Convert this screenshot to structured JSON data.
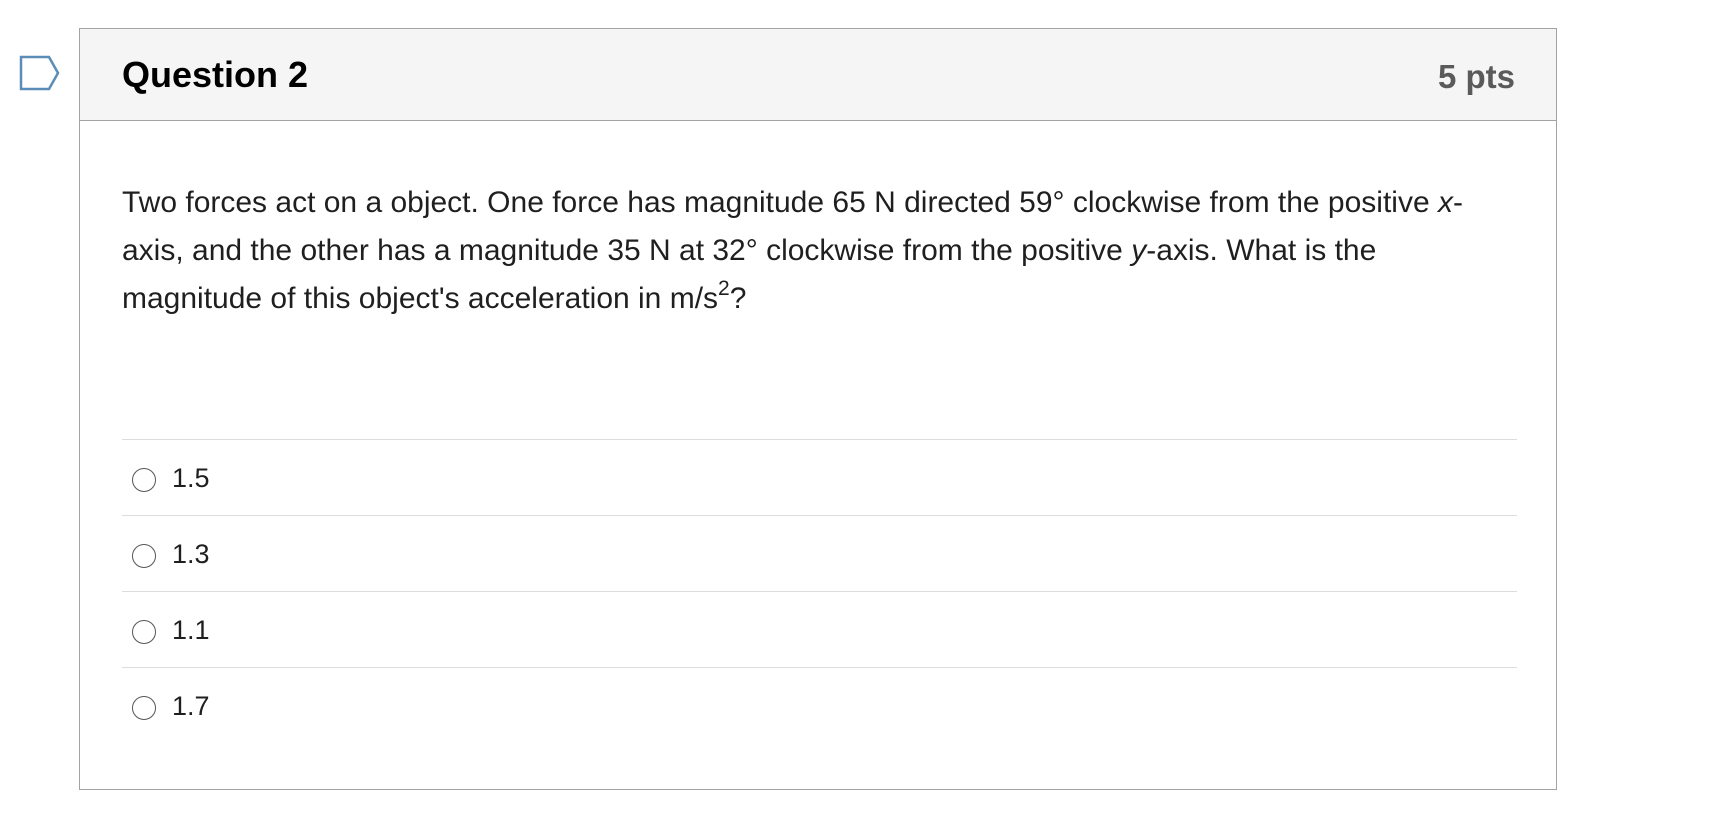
{
  "question": {
    "title": "Question 2",
    "points": "5 pts",
    "text_parts": {
      "p1": "Two forces act on a  object. One force has magnitude 65 N directed 59° clockwise from the positive ",
      "x_var": "x",
      "p2": "-axis, and the other has a magnitude 35 N at 32° clockwise from the positive ",
      "y_var": "y",
      "p3": "-axis. What is the magnitude of this object's acceleration in m/s",
      "exponent": "2",
      "p4": "?"
    }
  },
  "answers": [
    {
      "label": "1.5",
      "selected": false
    },
    {
      "label": "1.3",
      "selected": false
    },
    {
      "label": "1.1",
      "selected": false
    },
    {
      "label": "1.7",
      "selected": false
    }
  ],
  "icons": {
    "flag": "flag-question-icon",
    "flag_color": "#5b8db8"
  }
}
